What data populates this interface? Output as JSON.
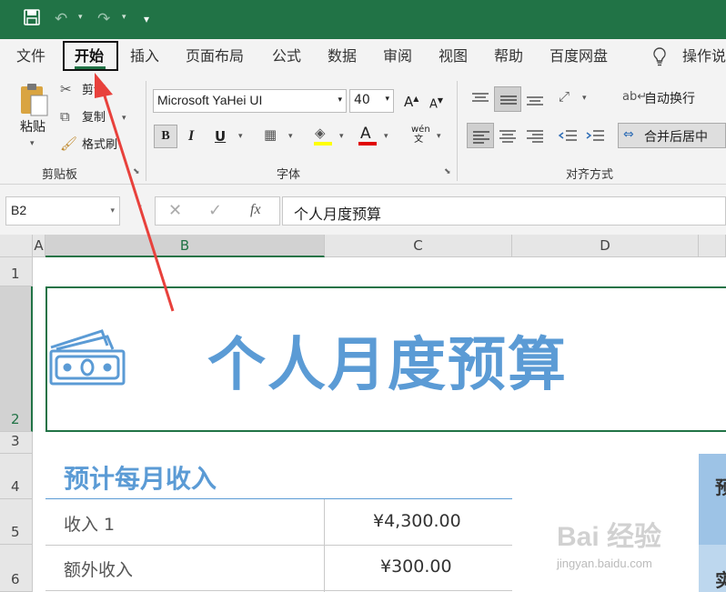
{
  "titlebar": {
    "save_icon": "save-icon",
    "undo_icon": "undo-icon",
    "redo_icon": "redo-icon",
    "customize_icon": "customize-quick-access-icon"
  },
  "tabs": {
    "file": "文件",
    "home": "开始",
    "insert": "插入",
    "page_layout": "页面布局",
    "formulas": "公式",
    "data": "数据",
    "review": "审阅",
    "view": "视图",
    "help": "帮助",
    "baidu_netdisk": "百度网盘",
    "tell_me": "操作说"
  },
  "ribbon": {
    "paste": "粘贴",
    "cut": "剪切",
    "copy": "复制",
    "format_painter": "格式刷",
    "clipboard_label": "剪贴板",
    "font_name": "Microsoft YaHei UI",
    "font_size": "40",
    "font_label": "字体",
    "wrap_text": "自动换行",
    "merge_center": "合并后居中",
    "alignment_label": "对齐方式",
    "phonetic": "wén\n文"
  },
  "formula_bar": {
    "name_box": "B2",
    "content": "个人月度预算",
    "fx": "fx"
  },
  "grid": {
    "columns": [
      "A",
      "B",
      "C",
      "D"
    ],
    "rows": [
      "1",
      "2",
      "3",
      "4",
      "5",
      "6"
    ],
    "title": "个人月度预算",
    "section_title": "预计每月收入",
    "income_rows": [
      {
        "label": "收入 1",
        "value": "¥4,300.00"
      },
      {
        "label": "额外收入",
        "value": "¥300.00"
      }
    ],
    "right_panel_top": "预",
    "right_panel_bottom": "实"
  },
  "watermark": {
    "main": "Bai 经验",
    "sub": "jingyan.baidu.com"
  },
  "colors": {
    "excel_green": "#217346",
    "title_blue": "#5b9bd5",
    "arrow_red": "#e8413c"
  }
}
